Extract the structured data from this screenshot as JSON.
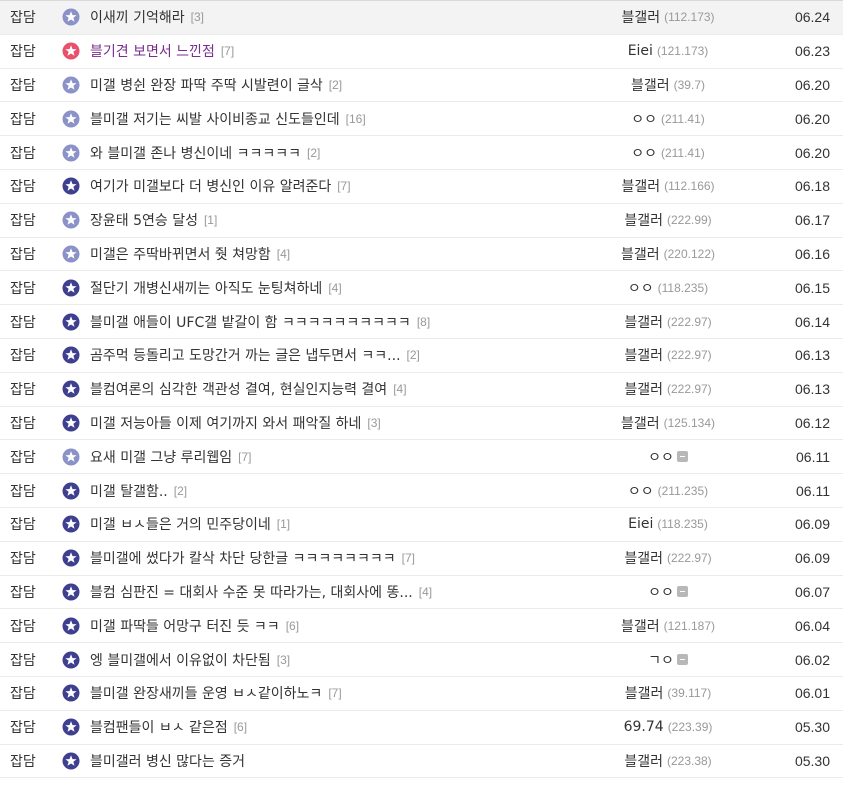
{
  "colors": {
    "icon_dark": "#3e3f8f",
    "icon_light": "#8b92c8",
    "icon_hot": "#e8506c",
    "hot_title": "#7a2c8f",
    "count": "#999999",
    "first_row_bg": "#f3f3f3"
  },
  "posts": [
    {
      "category": "잡담",
      "icon": "light",
      "title": "이새끼 기억해라",
      "comments": "[3]",
      "writer": "블갤러",
      "ip": "(112.173)",
      "mark": false,
      "date": "06.24"
    },
    {
      "category": "잡담",
      "icon": "hot",
      "title": "블기견 보면서 느낀점",
      "comments": "[7]",
      "writer": "Eiei",
      "ip": "(121.173)",
      "mark": false,
      "date": "06.23"
    },
    {
      "category": "잡담",
      "icon": "light",
      "title": "미갤 병쉰 완장 파딱 주딱 시발련이 글삭",
      "comments": "[2]",
      "writer": "블갤러",
      "ip": "(39.7)",
      "mark": false,
      "date": "06.20"
    },
    {
      "category": "잡담",
      "icon": "light",
      "title": "블미갤 저기는 씨발 사이비종교 신도들인데",
      "comments": "[16]",
      "writer": "ㅇㅇ",
      "ip": "(211.41)",
      "mark": false,
      "date": "06.20"
    },
    {
      "category": "잡담",
      "icon": "light",
      "title": "와 블미갤 존나 병신이네 ㅋㅋㅋㅋㅋ",
      "comments": "[2]",
      "writer": "ㅇㅇ",
      "ip": "(211.41)",
      "mark": false,
      "date": "06.20"
    },
    {
      "category": "잡담",
      "icon": "dark",
      "title": "여기가 미갤보다 더 병신인 이유 알려준다",
      "comments": "[7]",
      "writer": "블갤러",
      "ip": "(112.166)",
      "mark": false,
      "date": "06.18"
    },
    {
      "category": "잡담",
      "icon": "light",
      "title": "장윤태 5연승 달성",
      "comments": "[1]",
      "writer": "블갤러",
      "ip": "(222.99)",
      "mark": false,
      "date": "06.17"
    },
    {
      "category": "잡담",
      "icon": "light",
      "title": "미갤은 주딱바뀌면서 줫 쳐망함",
      "comments": "[4]",
      "writer": "블갤러",
      "ip": "(220.122)",
      "mark": false,
      "date": "06.16"
    },
    {
      "category": "잡담",
      "icon": "dark",
      "title": "절단기 개병신새끼는 아직도 눈팅쳐하네",
      "comments": "[4]",
      "writer": "ㅇㅇ",
      "ip": "(118.235)",
      "mark": false,
      "date": "06.15"
    },
    {
      "category": "잡담",
      "icon": "dark",
      "title": "블미갤 애들이 UFC갤 밭갈이 함 ㅋㅋㅋㅋㅋㅋㅋㅋㅋㅋ",
      "comments": "[8]",
      "writer": "블갤러",
      "ip": "(222.97)",
      "mark": false,
      "date": "06.14"
    },
    {
      "category": "잡담",
      "icon": "dark",
      "title": "곰주먹 등돌리고 도망간거 까는 글은 냅두면서 ㅋㅋ...",
      "comments": "[2]",
      "writer": "블갤러",
      "ip": "(222.97)",
      "mark": false,
      "date": "06.13"
    },
    {
      "category": "잡담",
      "icon": "dark",
      "title": "블컴여론의 심각한 객관성 결여, 현실인지능력 결여",
      "comments": "[4]",
      "writer": "블갤러",
      "ip": "(222.97)",
      "mark": false,
      "date": "06.13"
    },
    {
      "category": "잡담",
      "icon": "dark",
      "title": "미갤 저능아들 이제 여기까지 와서 패악질 하네",
      "comments": "[3]",
      "writer": "블갤러",
      "ip": "(125.134)",
      "mark": false,
      "date": "06.12"
    },
    {
      "category": "잡담",
      "icon": "light",
      "title": "요새 미갤 그냥 루리웹임",
      "comments": "[7]",
      "writer": "ㅇㅇ",
      "ip": "",
      "mark": true,
      "date": "06.11"
    },
    {
      "category": "잡담",
      "icon": "dark",
      "title": "미갤 탈갤함..",
      "comments": "[2]",
      "writer": "ㅇㅇ",
      "ip": "(211.235)",
      "mark": false,
      "date": "06.11"
    },
    {
      "category": "잡담",
      "icon": "dark",
      "title": "미갤 ㅂㅅ들은 거의 민주당이네",
      "comments": "[1]",
      "writer": "Eiei",
      "ip": "(118.235)",
      "mark": false,
      "date": "06.09"
    },
    {
      "category": "잡담",
      "icon": "dark",
      "title": "블미갤에 썼다가 칼삭 차단 당한글 ㅋㅋㅋㅋㅋㅋㅋㅋ",
      "comments": "[7]",
      "writer": "블갤러",
      "ip": "(222.97)",
      "mark": false,
      "date": "06.09"
    },
    {
      "category": "잡담",
      "icon": "dark",
      "title": "블컴 심판진 = 대회사 수준 못 따라가는, 대회사에 똥...",
      "comments": "[4]",
      "writer": "ㅇㅇ",
      "ip": "",
      "mark": true,
      "date": "06.07"
    },
    {
      "category": "잡담",
      "icon": "dark",
      "title": "미갤 파딱들 어망구 터진 듯 ㅋㅋ",
      "comments": "[6]",
      "writer": "블갤러",
      "ip": "(121.187)",
      "mark": false,
      "date": "06.04"
    },
    {
      "category": "잡담",
      "icon": "dark",
      "title": "엥 블미갤에서 이유없이 차단됨",
      "comments": "[3]",
      "writer": "ㄱㅇ",
      "ip": "",
      "mark": true,
      "date": "06.02"
    },
    {
      "category": "잡담",
      "icon": "dark",
      "title": "블미갤 완장새끼들 운영 ㅂㅅ같이하노ㅋ",
      "comments": "[7]",
      "writer": "블갤러",
      "ip": "(39.117)",
      "mark": false,
      "date": "06.01"
    },
    {
      "category": "잡담",
      "icon": "dark",
      "title": "블컴팬들이 ㅂㅅ 같은점",
      "comments": "[6]",
      "writer": "69.74",
      "ip": "(223.39)",
      "mark": false,
      "date": "05.30"
    },
    {
      "category": "잡담",
      "icon": "dark",
      "title": "블미갤러 병신 많다는 증거",
      "comments": "",
      "writer": "블갤러",
      "ip": "(223.38)",
      "mark": false,
      "date": "05.30"
    }
  ]
}
